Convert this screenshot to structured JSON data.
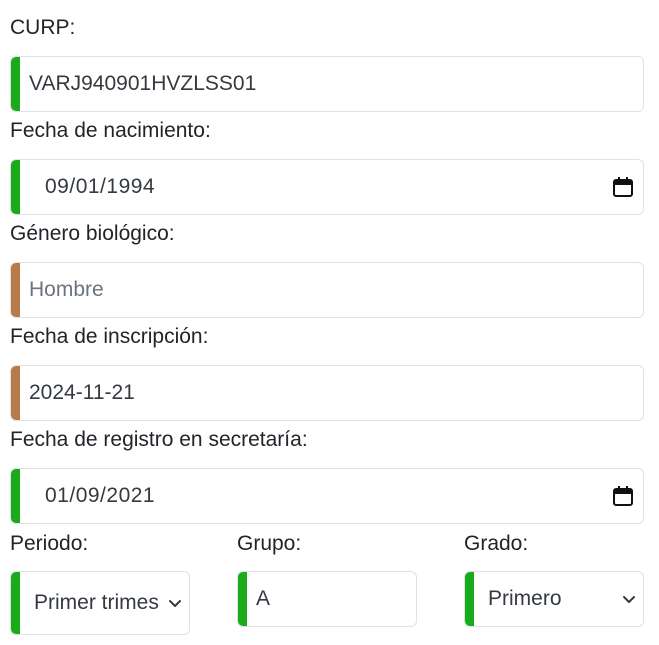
{
  "form": {
    "curp": {
      "label": "CURP:",
      "value": "VARJ940901HVZLSS01",
      "status_color": "#1aab1a"
    },
    "fecha_nacimiento": {
      "label": "Fecha de nacimiento:",
      "value": "09/01/1994",
      "icon": "calendar-icon",
      "status_color": "#1aab1a"
    },
    "genero": {
      "label": "Género biológico:",
      "placeholder": "Hombre",
      "value": "",
      "status_color": "#b87a48"
    },
    "fecha_inscripcion": {
      "label": "Fecha de inscripción:",
      "value": "2024-11-21",
      "status_color": "#b87a48"
    },
    "fecha_registro": {
      "label": "Fecha de registro en secretaría:",
      "value": "01/09/2021",
      "icon": "calendar-icon",
      "status_color": "#1aab1a"
    },
    "periodo": {
      "label": "Periodo:",
      "selected": "Primer trimes",
      "icon": "chevron-down-icon",
      "status_color": "#1aab1a"
    },
    "grupo": {
      "label": "Grupo:",
      "value": "A",
      "status_color": "#1aab1a"
    },
    "grado": {
      "label": "Grado:",
      "selected": "Primero",
      "icon": "chevron-down-icon",
      "status_color": "#1aab1a"
    }
  }
}
